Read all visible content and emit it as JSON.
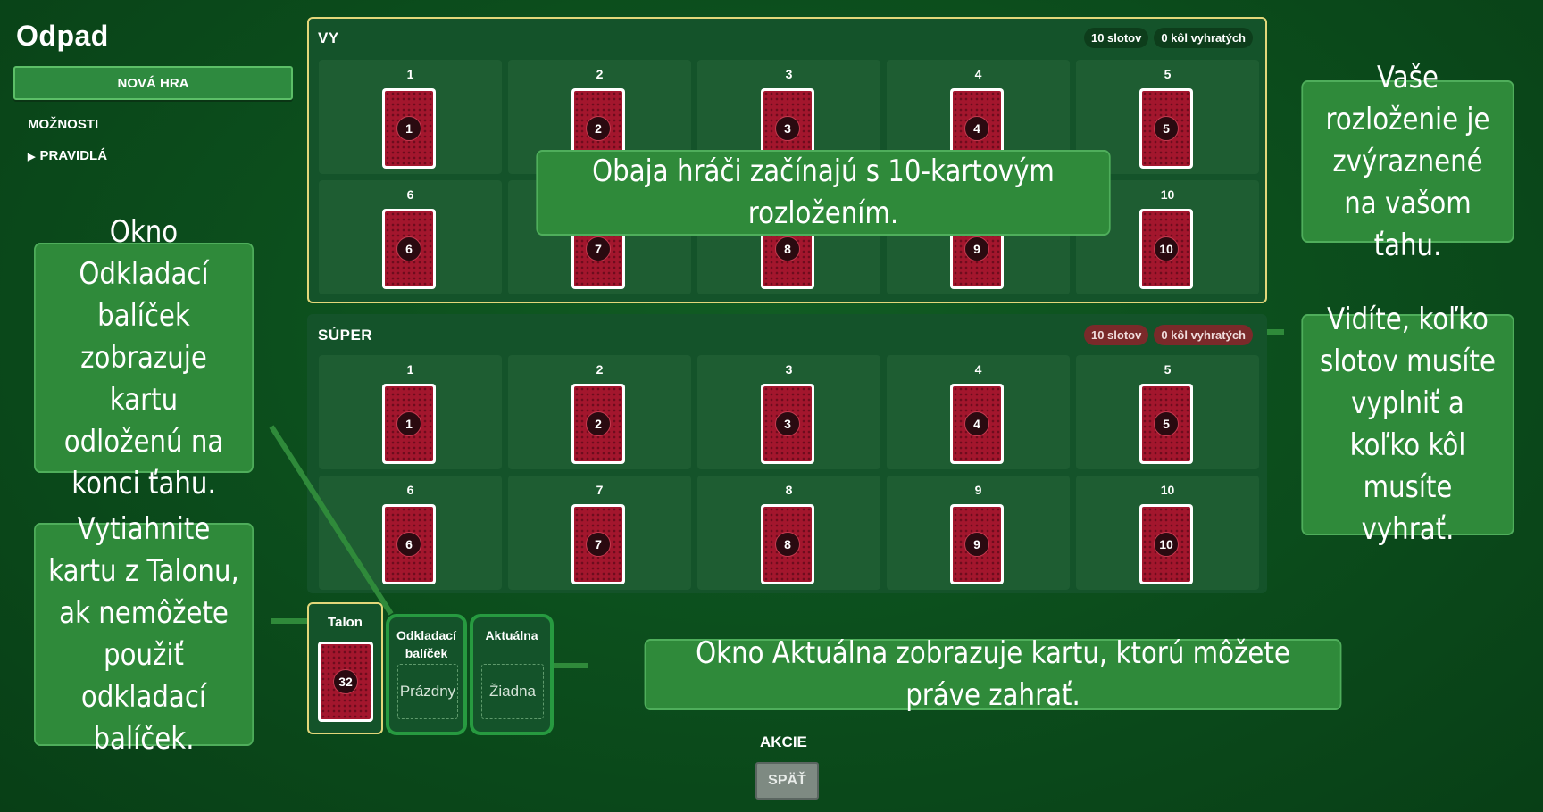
{
  "app": {
    "title": "Odpad"
  },
  "sidebar": {
    "new_game": "NOVÁ HRA",
    "options": "MOŽNOSTI",
    "rules": "PRAVIDLÁ"
  },
  "you": {
    "label": "VY",
    "slots_badge": "10 slotov",
    "rounds_badge": "0 kôl vyhratých",
    "slots": [
      "1",
      "2",
      "3",
      "4",
      "5",
      "6",
      "7",
      "8",
      "9",
      "10"
    ]
  },
  "opponent": {
    "label": "SÚPER",
    "slots_badge": "10 slotov",
    "rounds_badge": "0 kôl vyhratých",
    "slots": [
      "1",
      "2",
      "3",
      "4",
      "5",
      "6",
      "7",
      "8",
      "9",
      "10"
    ]
  },
  "piles": {
    "talon": {
      "label": "Talon",
      "count": "32"
    },
    "discard": {
      "label": "Odkladací balíček",
      "value": "Prázdny"
    },
    "current": {
      "label": "Aktuálna",
      "value": "Žiadna"
    }
  },
  "actions": {
    "title": "AKCIE",
    "back": "SPÄŤ"
  },
  "tutorial": {
    "layout": "Obaja hráči začínajú s 10-kartovým rozložením.",
    "highlight": "Vaše rozloženie je zvýraznené na vašom ťahu.",
    "discard": "Okno Odkladací balíček zobrazuje kartu odloženú na konci ťahu.",
    "slots_rounds": "Vidíte, koľko slotov musíte vyplniť a koľko kôl musíte vyhrať.",
    "talon": "Vytiahnite kartu z Talonu, ak nemôžete použiť odkladací balíček.",
    "current": "Okno Aktuálna zobrazuje kartu, ktorú môžete práve zahrať."
  },
  "colors": {
    "table": "#0c4f1d",
    "panel": "#14532a",
    "highlight": "#e3d77a",
    "card_back": "#a3162d",
    "callout": "#2f8a3a"
  }
}
